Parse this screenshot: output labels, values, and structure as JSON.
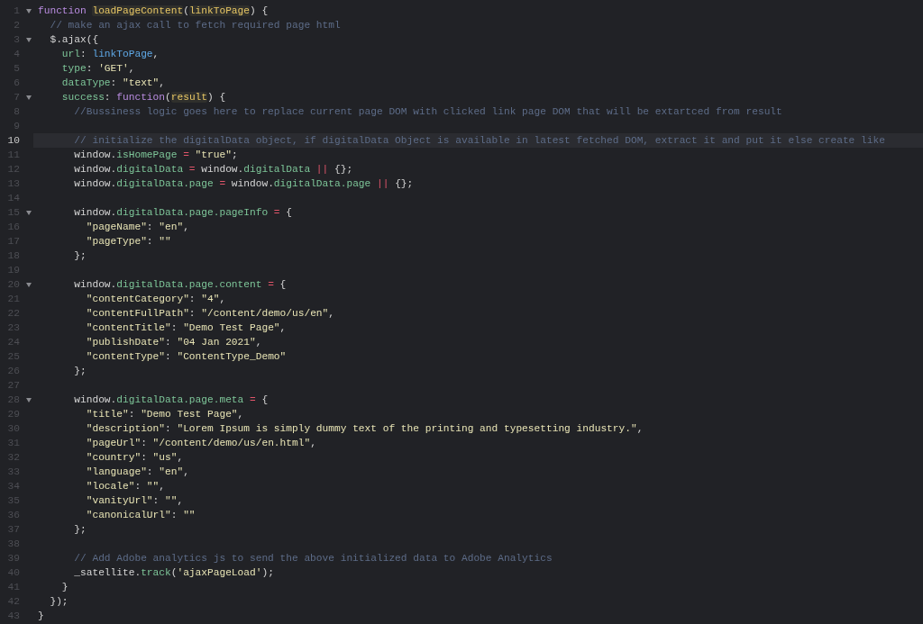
{
  "editor": {
    "lines": [
      {
        "number": "1",
        "fold": true,
        "current": false,
        "tokens": [
          {
            "text": "function ",
            "kind": "keyword"
          },
          {
            "text": "loadPageContent",
            "kind": "match"
          },
          {
            "text": "(",
            "kind": "plain"
          },
          {
            "text": "linkToPage",
            "kind": "match"
          },
          {
            "text": ") {",
            "kind": "plain"
          }
        ]
      },
      {
        "number": "2",
        "fold": false,
        "current": false,
        "tokens": [
          {
            "text": "  // make an ajax call to fetch required page html",
            "kind": "comment"
          }
        ]
      },
      {
        "number": "3",
        "fold": true,
        "current": false,
        "tokens": [
          {
            "text": "  $.ajax({",
            "kind": "plain"
          }
        ]
      },
      {
        "number": "4",
        "fold": false,
        "current": false,
        "tokens": [
          {
            "text": "    url",
            "kind": "property"
          },
          {
            "text": ": ",
            "kind": "plain"
          },
          {
            "text": "linkToPage",
            "kind": "variable"
          },
          {
            "text": ",",
            "kind": "plain"
          }
        ]
      },
      {
        "number": "5",
        "fold": false,
        "current": false,
        "tokens": [
          {
            "text": "    type",
            "kind": "property"
          },
          {
            "text": ": ",
            "kind": "plain"
          },
          {
            "text": "'GET'",
            "kind": "string"
          },
          {
            "text": ",",
            "kind": "plain"
          }
        ]
      },
      {
        "number": "6",
        "fold": false,
        "current": false,
        "tokens": [
          {
            "text": "    dataType",
            "kind": "property"
          },
          {
            "text": ": ",
            "kind": "plain"
          },
          {
            "text": "\"text\"",
            "kind": "string"
          },
          {
            "text": ",",
            "kind": "plain"
          }
        ]
      },
      {
        "number": "7",
        "fold": true,
        "current": false,
        "tokens": [
          {
            "text": "    success",
            "kind": "property"
          },
          {
            "text": ": ",
            "kind": "plain"
          },
          {
            "text": "function",
            "kind": "keyword"
          },
          {
            "text": "(",
            "kind": "plain"
          },
          {
            "text": "result",
            "kind": "match"
          },
          {
            "text": ") {",
            "kind": "plain"
          }
        ]
      },
      {
        "number": "8",
        "fold": false,
        "current": false,
        "tokens": [
          {
            "text": "      //Bussiness logic goes here to replace current page DOM with clicked link page DOM that will be extartced from result",
            "kind": "comment"
          }
        ]
      },
      {
        "number": "9",
        "fold": false,
        "current": false
      },
      {
        "number": "10",
        "fold": false,
        "current": true,
        "tokens": [
          {
            "text": "      // initialize the digitalData object, if digitalData Object is available in latest fetched DOM, extract it and put it else create like",
            "kind": "comment"
          }
        ]
      },
      {
        "number": "11",
        "fold": false,
        "current": false,
        "tokens": [
          {
            "text": "      window.",
            "kind": "plain"
          },
          {
            "text": "isHomePage",
            "kind": "property"
          },
          {
            "text": " = ",
            "kind": "operator"
          },
          {
            "text": "\"true\"",
            "kind": "string"
          },
          {
            "text": ";",
            "kind": "plain"
          }
        ]
      },
      {
        "number": "12",
        "fold": false,
        "current": false,
        "tokens": [
          {
            "text": "      window.",
            "kind": "plain"
          },
          {
            "text": "digitalData",
            "kind": "property"
          },
          {
            "text": " = ",
            "kind": "operator"
          },
          {
            "text": "window.",
            "kind": "plain"
          },
          {
            "text": "digitalData",
            "kind": "property"
          },
          {
            "text": " || ",
            "kind": "operator"
          },
          {
            "text": "{};",
            "kind": "plain"
          }
        ]
      },
      {
        "number": "13",
        "fold": false,
        "current": false,
        "tokens": [
          {
            "text": "      window.",
            "kind": "plain"
          },
          {
            "text": "digitalData.page",
            "kind": "property"
          },
          {
            "text": " = ",
            "kind": "operator"
          },
          {
            "text": "window.",
            "kind": "plain"
          },
          {
            "text": "digitalData.page",
            "kind": "property"
          },
          {
            "text": " || ",
            "kind": "operator"
          },
          {
            "text": "{};",
            "kind": "plain"
          }
        ]
      },
      {
        "number": "14",
        "fold": false,
        "current": false
      },
      {
        "number": "15",
        "fold": true,
        "current": false,
        "tokens": [
          {
            "text": "      window.",
            "kind": "plain"
          },
          {
            "text": "digitalData.page.pageInfo",
            "kind": "property"
          },
          {
            "text": " = ",
            "kind": "operator"
          },
          {
            "text": "{",
            "kind": "plain"
          }
        ]
      },
      {
        "number": "16",
        "fold": false,
        "current": false,
        "tokens": [
          {
            "text": "        \"pageName\"",
            "kind": "string"
          },
          {
            "text": ": ",
            "kind": "plain"
          },
          {
            "text": "\"en\"",
            "kind": "string"
          },
          {
            "text": ",",
            "kind": "plain"
          }
        ]
      },
      {
        "number": "17",
        "fold": false,
        "current": false,
        "tokens": [
          {
            "text": "        \"pageType\"",
            "kind": "string"
          },
          {
            "text": ": ",
            "kind": "plain"
          },
          {
            "text": "\"\"",
            "kind": "string"
          }
        ]
      },
      {
        "number": "18",
        "fold": false,
        "current": false,
        "tokens": [
          {
            "text": "      };",
            "kind": "plain"
          }
        ]
      },
      {
        "number": "19",
        "fold": false,
        "current": false
      },
      {
        "number": "20",
        "fold": true,
        "current": false,
        "tokens": [
          {
            "text": "      window.",
            "kind": "plain"
          },
          {
            "text": "digitalData.page.content",
            "kind": "property"
          },
          {
            "text": " = ",
            "kind": "operator"
          },
          {
            "text": "{",
            "kind": "plain"
          }
        ]
      },
      {
        "number": "21",
        "fold": false,
        "current": false,
        "tokens": [
          {
            "text": "        \"contentCategory\"",
            "kind": "string"
          },
          {
            "text": ": ",
            "kind": "plain"
          },
          {
            "text": "\"4\"",
            "kind": "string"
          },
          {
            "text": ",",
            "kind": "plain"
          }
        ]
      },
      {
        "number": "22",
        "fold": false,
        "current": false,
        "tokens": [
          {
            "text": "        \"contentFullPath\"",
            "kind": "string"
          },
          {
            "text": ": ",
            "kind": "plain"
          },
          {
            "text": "\"/content/demo/us/en\"",
            "kind": "string"
          },
          {
            "text": ",",
            "kind": "plain"
          }
        ]
      },
      {
        "number": "23",
        "fold": false,
        "current": false,
        "tokens": [
          {
            "text": "        \"contentTitle\"",
            "kind": "string"
          },
          {
            "text": ": ",
            "kind": "plain"
          },
          {
            "text": "\"Demo Test Page\"",
            "kind": "string"
          },
          {
            "text": ",",
            "kind": "plain"
          }
        ]
      },
      {
        "number": "24",
        "fold": false,
        "current": false,
        "tokens": [
          {
            "text": "        \"publishDate\"",
            "kind": "string"
          },
          {
            "text": ": ",
            "kind": "plain"
          },
          {
            "text": "\"04 Jan 2021\"",
            "kind": "string"
          },
          {
            "text": ",",
            "kind": "plain"
          }
        ]
      },
      {
        "number": "25",
        "fold": false,
        "current": false,
        "tokens": [
          {
            "text": "        \"contentType\"",
            "kind": "string"
          },
          {
            "text": ": ",
            "kind": "plain"
          },
          {
            "text": "\"ContentType_Demo\"",
            "kind": "string"
          }
        ]
      },
      {
        "number": "26",
        "fold": false,
        "current": false,
        "tokens": [
          {
            "text": "      };",
            "kind": "plain"
          }
        ]
      },
      {
        "number": "27",
        "fold": false,
        "current": false
      },
      {
        "number": "28",
        "fold": true,
        "current": false,
        "tokens": [
          {
            "text": "      window.",
            "kind": "plain"
          },
          {
            "text": "digitalData.page.meta",
            "kind": "property"
          },
          {
            "text": " = ",
            "kind": "operator"
          },
          {
            "text": "{",
            "kind": "plain"
          }
        ]
      },
      {
        "number": "29",
        "fold": false,
        "current": false,
        "tokens": [
          {
            "text": "        \"title\"",
            "kind": "string"
          },
          {
            "text": ": ",
            "kind": "plain"
          },
          {
            "text": "\"Demo Test Page\"",
            "kind": "string"
          },
          {
            "text": ",",
            "kind": "plain"
          }
        ]
      },
      {
        "number": "30",
        "fold": false,
        "current": false,
        "tokens": [
          {
            "text": "        \"description\"",
            "kind": "string"
          },
          {
            "text": ": ",
            "kind": "plain"
          },
          {
            "text": "\"Lorem Ipsum is simply dummy text of the printing and typesetting industry.\"",
            "kind": "string"
          },
          {
            "text": ",",
            "kind": "plain"
          }
        ]
      },
      {
        "number": "31",
        "fold": false,
        "current": false,
        "tokens": [
          {
            "text": "        \"pageUrl\"",
            "kind": "string"
          },
          {
            "text": ": ",
            "kind": "plain"
          },
          {
            "text": "\"/content/demo/us/en.html\"",
            "kind": "string"
          },
          {
            "text": ",",
            "kind": "plain"
          }
        ]
      },
      {
        "number": "32",
        "fold": false,
        "current": false,
        "tokens": [
          {
            "text": "        \"country\"",
            "kind": "string"
          },
          {
            "text": ": ",
            "kind": "plain"
          },
          {
            "text": "\"us\"",
            "kind": "string"
          },
          {
            "text": ",",
            "kind": "plain"
          }
        ]
      },
      {
        "number": "33",
        "fold": false,
        "current": false,
        "tokens": [
          {
            "text": "        \"language\"",
            "kind": "string"
          },
          {
            "text": ": ",
            "kind": "plain"
          },
          {
            "text": "\"en\"",
            "kind": "string"
          },
          {
            "text": ",",
            "kind": "plain"
          }
        ]
      },
      {
        "number": "34",
        "fold": false,
        "current": false,
        "tokens": [
          {
            "text": "        \"locale\"",
            "kind": "string"
          },
          {
            "text": ": ",
            "kind": "plain"
          },
          {
            "text": "\"\"",
            "kind": "string"
          },
          {
            "text": ",",
            "kind": "plain"
          }
        ]
      },
      {
        "number": "35",
        "fold": false,
        "current": false,
        "tokens": [
          {
            "text": "        \"vanityUrl\"",
            "kind": "string"
          },
          {
            "text": ": ",
            "kind": "plain"
          },
          {
            "text": "\"\"",
            "kind": "string"
          },
          {
            "text": ",",
            "kind": "plain"
          }
        ]
      },
      {
        "number": "36",
        "fold": false,
        "current": false,
        "tokens": [
          {
            "text": "        \"canonicalUrl\"",
            "kind": "string"
          },
          {
            "text": ": ",
            "kind": "plain"
          },
          {
            "text": "\"\"",
            "kind": "string"
          }
        ]
      },
      {
        "number": "37",
        "fold": false,
        "current": false,
        "tokens": [
          {
            "text": "      };",
            "kind": "plain"
          }
        ]
      },
      {
        "number": "38",
        "fold": false,
        "current": false
      },
      {
        "number": "39",
        "fold": false,
        "current": false,
        "tokens": [
          {
            "text": "      // Add Adobe analytics js to send the above initialized data to Adobe Analytics",
            "kind": "comment"
          }
        ]
      },
      {
        "number": "40",
        "fold": false,
        "current": false,
        "tokens": [
          {
            "text": "      _satellite.",
            "kind": "plain"
          },
          {
            "text": "track",
            "kind": "property"
          },
          {
            "text": "(",
            "kind": "plain"
          },
          {
            "text": "'ajaxPageLoad'",
            "kind": "string"
          },
          {
            "text": ");",
            "kind": "plain"
          }
        ]
      },
      {
        "number": "41",
        "fold": false,
        "current": false,
        "tokens": [
          {
            "text": "    }",
            "kind": "plain"
          }
        ]
      },
      {
        "number": "42",
        "fold": false,
        "current": false,
        "tokens": [
          {
            "text": "  });",
            "kind": "plain"
          }
        ]
      },
      {
        "number": "43",
        "fold": false,
        "current": false,
        "tokens": [
          {
            "text": "}",
            "kind": "plain"
          }
        ]
      }
    ]
  }
}
